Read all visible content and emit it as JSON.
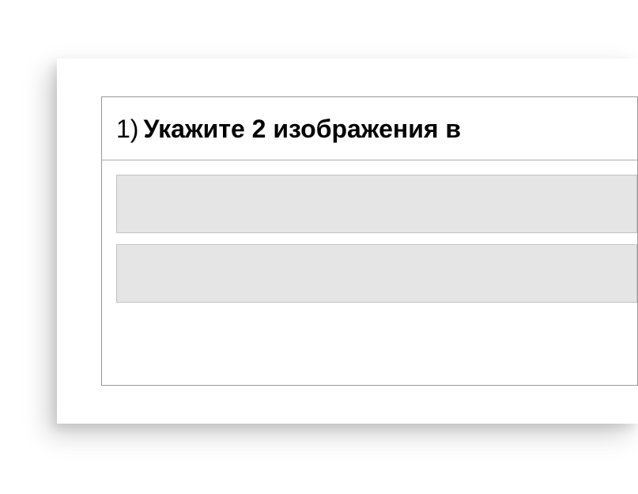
{
  "question": {
    "number": "1)",
    "text": "Укажите 2 изображения в"
  }
}
